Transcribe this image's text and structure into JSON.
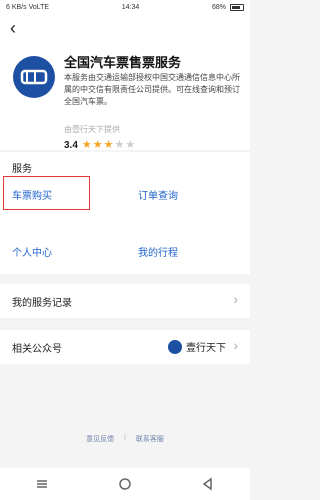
{
  "status_bar": {
    "signal": "6 KB/s VoLTE",
    "time": "14:34",
    "battery": "68%"
  },
  "app": {
    "name": "全国汽车票售票服务",
    "description": "本服务由交通运输部授权中国交通通信信息中心所属的中交信有限责任公司提供。可在线查询和预订全国汽车票。",
    "provider": "由壹行天下提供",
    "rating": "3.4",
    "stars_filled": 3.4,
    "stars_total": 5
  },
  "services": {
    "title": "服务",
    "items": [
      {
        "label": "车票购买"
      },
      {
        "label": "订单查询"
      },
      {
        "label": "个人中心"
      },
      {
        "label": "我的行程"
      }
    ]
  },
  "records": {
    "label": "我的服务记录"
  },
  "account": {
    "label": "相关公众号",
    "name": "壹行天下"
  },
  "footer": {
    "feedback": "意见反馈",
    "service": "联系客服"
  },
  "colors": {
    "accent": "#2266cc",
    "highlight": "#e53935",
    "star": "#f5a623",
    "logo": "#1d4fa3"
  }
}
